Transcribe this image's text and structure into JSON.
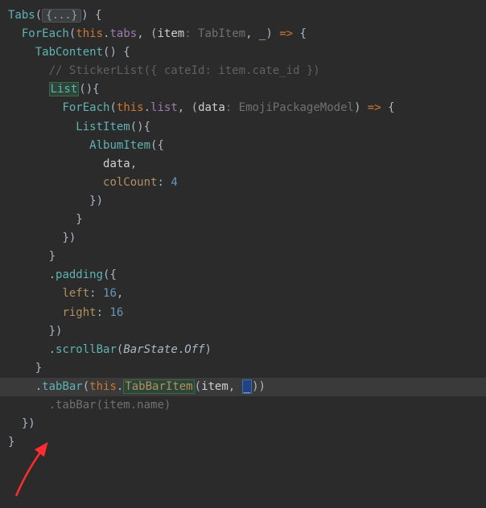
{
  "code": {
    "l1_tabs": "Tabs",
    "l1_ellipsis": "{...}",
    "l2_foreach": "ForEach",
    "l2_this": "this",
    "l2_tabs_field": "tabs",
    "l2_item": "item",
    "l2_item_hint": ": TabItem",
    "l2_underscore": "_",
    "l2_arrow": "=>",
    "l3_tabcontent": "TabContent",
    "l4_comment": "// StickerList({ cateId: item.cate_id })",
    "l5_list": "List",
    "l6_foreach": "ForEach",
    "l6_this": "this",
    "l6_list_field": "list",
    "l6_data": "data",
    "l6_data_hint": ": EmojiPackageModel",
    "l6_arrow": "=>",
    "l7_listitem": "ListItem",
    "l8_albumitem": "AlbumItem",
    "l9_data": "data",
    "l10_colcount": "colCount",
    "l10_val": "4",
    "l15_padding": "padding",
    "l16_left": "left",
    "l16_left_val": "16",
    "l17_right": "right",
    "l17_right_val": "16",
    "l19_scrollbar": "scrollBar",
    "l19_barstate": "BarState",
    "l19_off": "Off",
    "l21_tabbar": "tabBar",
    "l21_this": "this",
    "l21_tabbaritem": "TabBarItem",
    "l21_item": "item",
    "l21_underscore": "_",
    "l22_dim": ".tabBar(item.name)"
  }
}
